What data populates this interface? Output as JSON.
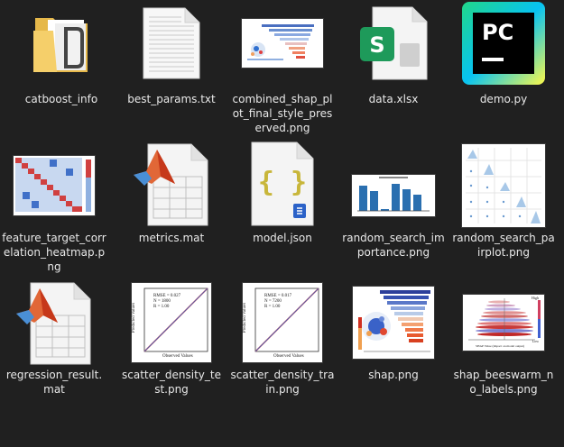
{
  "desktop": {
    "files": [
      {
        "name": "catboost_info",
        "icon": "folder-icon"
      },
      {
        "name": "best_params.txt",
        "icon": "text-file-icon"
      },
      {
        "name": "combined_shap_plot_final_style_preserved.png",
        "icon": "image-thumbnail"
      },
      {
        "name": "data.xlsx",
        "icon": "excel-icon"
      },
      {
        "name": "demo.py",
        "icon": "pycharm-icon"
      },
      {
        "name": "feature_target_correlation_heatmap.png",
        "icon": "image-thumbnail"
      },
      {
        "name": "metrics.mat",
        "icon": "matlab-file-icon"
      },
      {
        "name": "model.json",
        "icon": "json-file-icon"
      },
      {
        "name": "random_search_importance.png",
        "icon": "image-thumbnail"
      },
      {
        "name": "random_search_pairplot.png",
        "icon": "image-thumbnail"
      },
      {
        "name": "regression_result.mat",
        "icon": "matlab-file-icon"
      },
      {
        "name": "scatter_density_test.png",
        "icon": "image-thumbnail"
      },
      {
        "name": "scatter_density_train.png",
        "icon": "image-thumbnail"
      },
      {
        "name": "shap.png",
        "icon": "image-thumbnail"
      },
      {
        "name": "shap_beeswarm_no_labels.png",
        "icon": "image-thumbnail"
      }
    ]
  },
  "thumbs": {
    "scatter_test": {
      "lines": [
        "RMSE = 0.027",
        "N = 1800",
        "R = 1.00"
      ],
      "ylabel": "Predicted Values",
      "xlabel": "Observed Values"
    },
    "scatter_train": {
      "lines": [
        "RMSE = 0.017",
        "N = 7200",
        "R = 1.00"
      ],
      "ylabel": "Predicted Values",
      "xlabel": "Observed Values"
    },
    "beeswarm": {
      "high": "High",
      "low": "Low",
      "axis": "Feature Value",
      "xlabel": "SHAP Value (impact on model output)"
    }
  },
  "colors": {
    "background": "#202020",
    "excel_green": "#21a366",
    "pycharm_gradient": [
      "#21d789",
      "#fcf84a",
      "#07c3f2"
    ],
    "folder": "#f0c050"
  }
}
